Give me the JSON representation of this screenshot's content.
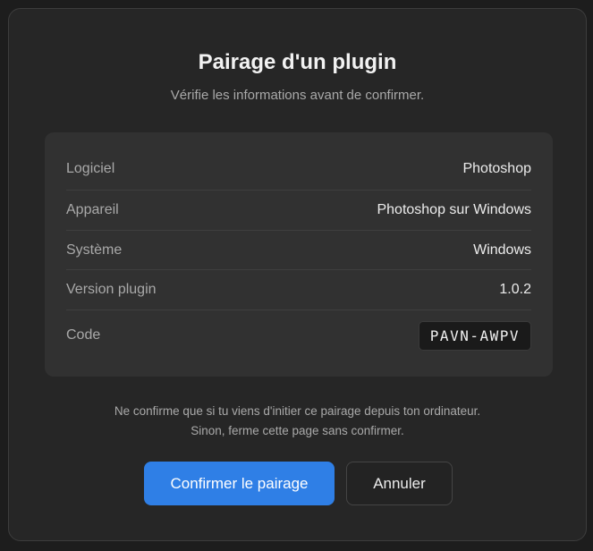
{
  "dialog": {
    "title": "Pairage d'un plugin",
    "subtitle": "Vérifie les informations avant de confirmer.",
    "details": [
      {
        "label": "Logiciel",
        "value": "Photoshop"
      },
      {
        "label": "Appareil",
        "value": "Photoshop sur Windows"
      },
      {
        "label": "Système",
        "value": "Windows"
      },
      {
        "label": "Version plugin",
        "value": "1.0.2"
      }
    ],
    "code": {
      "label": "Code",
      "value": "PAVN-AWPV"
    },
    "notice_line1": "Ne confirme que si tu viens d'initier ce pairage depuis ton ordinateur.",
    "notice_line2": "Sinon, ferme cette page sans confirmer.",
    "confirm_label": "Confirmer le pairage",
    "cancel_label": "Annuler"
  },
  "colors": {
    "accent": "#2f7fe6",
    "background": "#1d1d1d",
    "card": "#313131"
  }
}
